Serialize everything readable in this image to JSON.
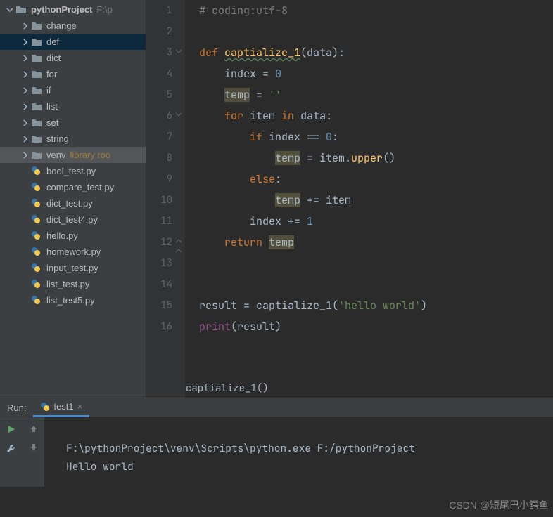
{
  "tree": {
    "root": "pythonProject",
    "root_path": "F:\\p",
    "folders": [
      "change",
      "def",
      "dict",
      "for",
      "if",
      "list",
      "set",
      "string"
    ],
    "venv": {
      "name": "venv",
      "extra": "library roo"
    },
    "files": [
      "bool_test.py",
      "compare_test.py",
      "dict_test.py",
      "dict_test4.py",
      "hello.py",
      "homework.py",
      "input_test.py",
      "list_test.py",
      "list_test5.py"
    ],
    "selected_folder": "def"
  },
  "code": {
    "lines": [
      "# coding:utf-8",
      "",
      "def captialize_1(data):",
      "    index = 0",
      "    temp = ''",
      "    for item in data:",
      "        if index == 0:",
      "            temp = item.upper()",
      "        else:",
      "            temp += item",
      "        index += 1",
      "    return temp",
      "",
      "",
      "result = captialize_1('hello world')",
      "print(result)"
    ],
    "breadcrumb": "captialize_1()"
  },
  "run": {
    "label": "Run:",
    "tab": "test1",
    "close": "×",
    "output_path": "F:\\pythonProject\\venv\\Scripts\\python.exe F:/pythonProject",
    "output_line": "Hello world"
  },
  "watermark": "CSDN @短尾巴小鳄鱼"
}
